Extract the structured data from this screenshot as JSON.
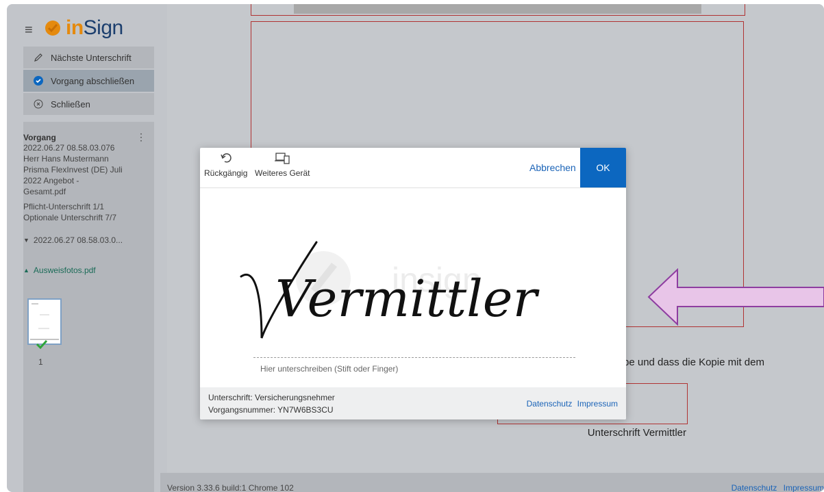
{
  "app": {
    "brand_in": "in",
    "brand_sign": "Sign"
  },
  "menu": {
    "items": [
      {
        "label": "Nächste Unterschrift",
        "icon": "pen-icon"
      },
      {
        "label": "Vorgang abschließen",
        "icon": "check-circle-icon"
      },
      {
        "label": "Schließen",
        "icon": "close-circle-icon"
      }
    ]
  },
  "vorgang": {
    "title": "Vorgang",
    "lines": [
      "2022.06.27 08.58.03.076",
      "Herr Hans Mustermann",
      "Prisma FlexInvest (DE) Juli",
      "2022 Angebot -",
      "Gesamt.pdf"
    ],
    "status_lines": [
      "Pflicht-Unterschrift 1/1",
      "Optionale Unterschrift 7/7"
    ],
    "group_1": "2022.06.27 08.58.03.0...",
    "group_2": "Ausweisfotos.pdf",
    "thumb_page": "1"
  },
  "document": {
    "partial_text": "be und dass die Kopie mit dem",
    "sig_label": "Unterschrift Vermittler"
  },
  "footer": {
    "version": "Version 3.33.6 build:1 Chrome 102",
    "datenschutz": "Datenschutz",
    "impressum": "Impressum"
  },
  "modal": {
    "undo_label": "Rückgängig",
    "device_label": "Weiteres Gerät",
    "cancel_label": "Abbrechen",
    "ok_label": "OK",
    "hint": "Hier unterschreiben (Stift oder Finger)",
    "signature_text": "Vermittler",
    "watermark_text": "insign",
    "footer_signer": "Unterschrift: Versicherungsnehmer",
    "footer_process": "Vorgangsnummer: YN7W6BS3CU",
    "link_privacy": "Datenschutz",
    "link_imprint": "Impressum"
  },
  "colors": {
    "accent": "#0c67c0",
    "brand_orange": "#e58a0e",
    "brand_blue": "#1c3f6e",
    "doc_border": "#b03232",
    "arrow_fill": "#e8c5e8",
    "arrow_stroke": "#8e3da0"
  }
}
